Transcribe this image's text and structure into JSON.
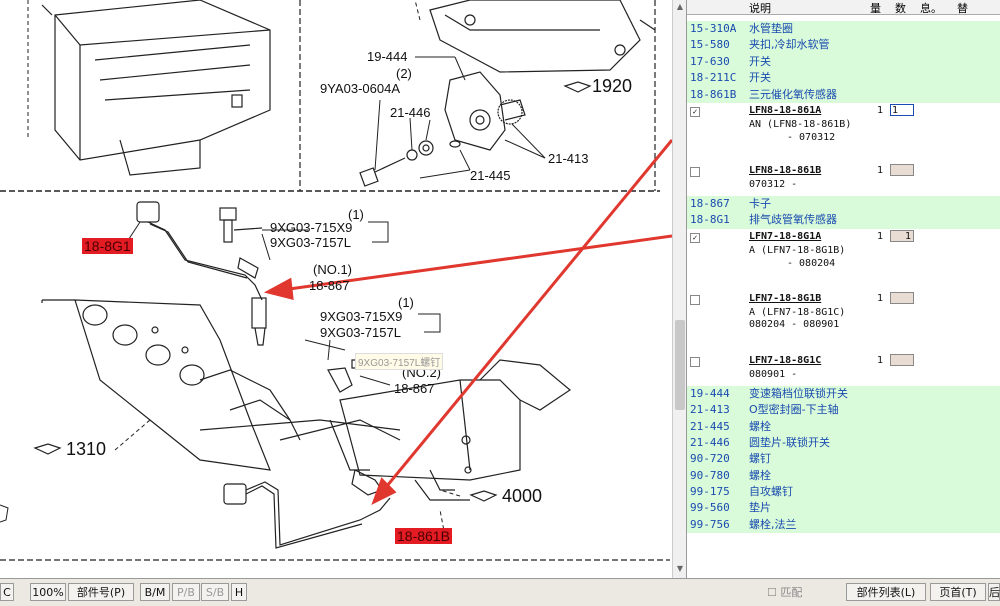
{
  "diagram": {
    "labels": {
      "p19444": "19-444",
      "qty2": "(2)",
      "p9ya03": "9YA03-0604A",
      "p21446": "21-446",
      "p21445": "21-445",
      "p21413": "21-413",
      "qty1a": "(1)",
      "p9xg715a": "9XG03-715X9",
      "p9xg7157a": "9XG03-7157L",
      "no1": "(NO.1)",
      "p18867a": "18-867",
      "qty1b": "(1)",
      "p9xg715b": "9XG03-715X9",
      "p9xg7157b": "9XG03-7157L",
      "no2": "(NO.2)",
      "p18867b": "18-867"
    },
    "callouts": {
      "c1920": "1920",
      "c1310": "1310",
      "c4000": "4000"
    },
    "highlights": {
      "h18861b": "18-861B",
      "h188g1": "18-8G1"
    },
    "tooltip": "9XG03-7157L螺钉"
  },
  "parts_header": {
    "desc": "说明",
    "qty": "量",
    "num": "数",
    "info": "息。",
    "alt": "替"
  },
  "parts": [
    {
      "code": "15-310A",
      "desc": "水管垫圈"
    },
    {
      "code": "15-580",
      "desc": "夹扣,冷却水软管"
    },
    {
      "code": "17-630",
      "desc": "开关"
    },
    {
      "code": "18-211C",
      "desc": "开关"
    },
    {
      "code": "18-861B",
      "desc": "三元催化氧传感器"
    }
  ],
  "subparts_a": [
    {
      "pn": "LFN8-18-861A",
      "l2": "AN (LFN8-18-861B)",
      "l3": "- 070312",
      "qty": "1",
      "box": "1",
      "checked": "✓"
    },
    {
      "pn": "LFN8-18-861B",
      "l2": "070312  -",
      "l3": "",
      "qty": "1",
      "box": "",
      "checked": ""
    }
  ],
  "parts2": [
    {
      "code": "18-867",
      "desc": "卡子"
    },
    {
      "code": "18-8G1",
      "desc": "排气歧管氧传感器"
    }
  ],
  "subparts_b": [
    {
      "pn": "LFN7-18-8G1A",
      "l2": "A (LFN7-18-8G1B)",
      "l3": "- 080204",
      "qty": "1",
      "box": "1",
      "checked": "✓"
    },
    {
      "pn": "LFN7-18-8G1B",
      "l2": "A (LFN7-18-8G1C)",
      "l3": "080204  -  080901",
      "qty": "1",
      "box": "",
      "checked": ""
    },
    {
      "pn": "LFN7-18-8G1C",
      "l2": "080901  -",
      "l3": "",
      "qty": "1",
      "box": "",
      "checked": ""
    }
  ],
  "parts3": [
    {
      "code": "19-444",
      "desc": "变速箱档位联锁开关"
    },
    {
      "code": "21-413",
      "desc": "O型密封圈-下主轴"
    },
    {
      "code": "21-445",
      "desc": "螺栓"
    },
    {
      "code": "21-446",
      "desc": "圆垫片-联锁开关"
    },
    {
      "code": "90-720",
      "desc": "螺钉"
    },
    {
      "code": "90-780",
      "desc": "螺栓"
    },
    {
      "code": "99-175",
      "desc": "自攻螺钉"
    },
    {
      "code": "99-560",
      "desc": "垫片"
    },
    {
      "code": "99-756",
      "desc": "螺栓,法兰"
    }
  ],
  "toolbar": {
    "c": "C",
    "zoom": "100%",
    "partno": "部件号(P)",
    "bm": "B/M",
    "pb": "P/B",
    "sb": "S/B",
    "h": "H",
    "match": "匹配",
    "partlist": "部件列表(L)",
    "home": "页首(T)",
    "last": "后"
  },
  "colors": {
    "highlight": "#e31b23",
    "row_bg": "#d9fbd9",
    "row_text": "#1a4bb0",
    "arrow": "#e0372f"
  }
}
